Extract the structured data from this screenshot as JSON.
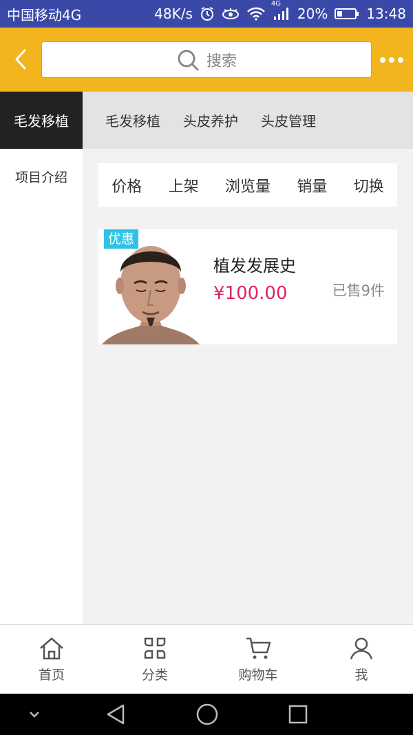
{
  "status_bar": {
    "carrier": "中国移动4G",
    "speed": "48K/s",
    "network_badge": "4G",
    "battery": "20%",
    "time": "13:48"
  },
  "header": {
    "search_placeholder": "搜索"
  },
  "category_active": "毛发移植",
  "tabs": [
    "毛发移植",
    "头皮养护",
    "头皮管理"
  ],
  "sidebar": {
    "items": [
      "项目介绍"
    ]
  },
  "sort_bar": [
    "价格",
    "上架",
    "浏览量",
    "销量",
    "切换"
  ],
  "product": {
    "badge": "优惠",
    "title": "植发发展史",
    "price": "¥100.00",
    "sold": "已售9件"
  },
  "bottom_nav": [
    "首页",
    "分类",
    "购物车",
    "我"
  ],
  "colors": {
    "header": "#f3b51e",
    "statusbar": "#3a49a8",
    "price": "#e0245e",
    "badge": "#2ec3e6"
  }
}
